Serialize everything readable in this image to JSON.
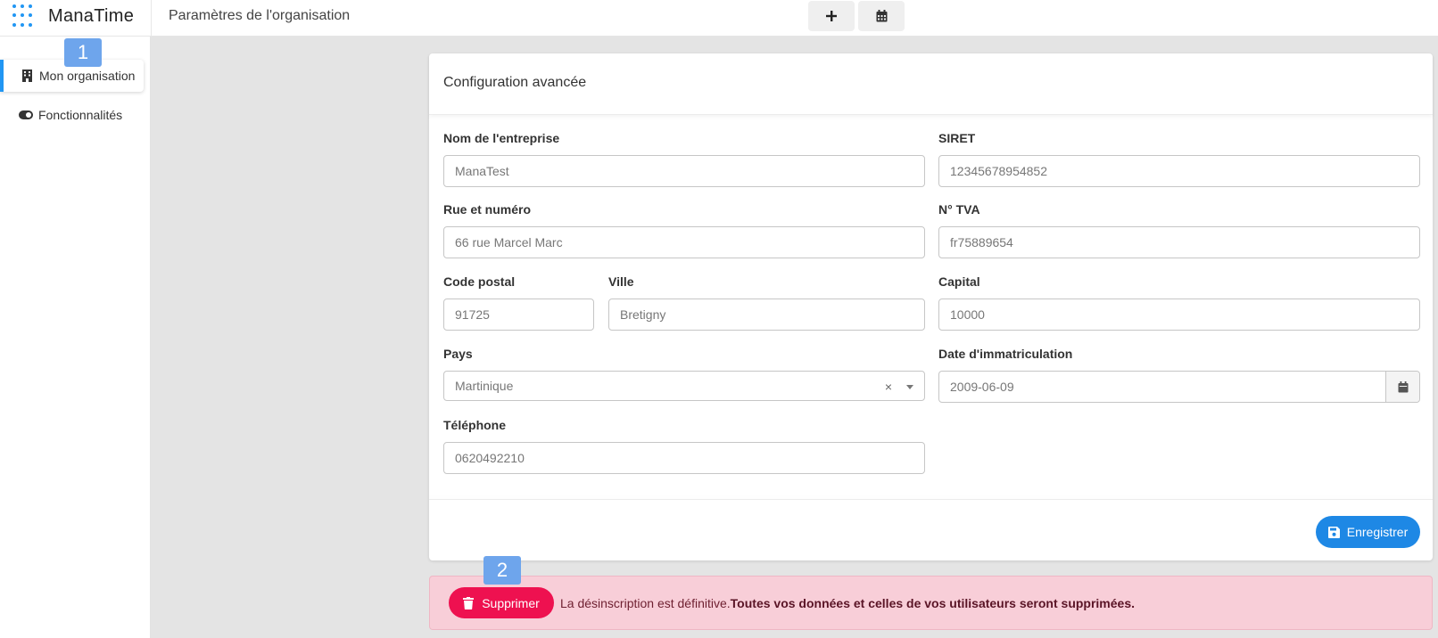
{
  "app": {
    "name": "ManaTime"
  },
  "header": {
    "page_title": "Paramètres de l'organisation"
  },
  "sidebar": {
    "items": [
      {
        "label": "Mon organisation",
        "icon": "building-icon",
        "active": true
      },
      {
        "label": "Fonctionnalités",
        "icon": "toggle-icon",
        "active": false
      }
    ]
  },
  "badges": {
    "first": "1",
    "second": "2"
  },
  "form": {
    "title": "Configuration avancée",
    "company_name": {
      "label": "Nom de l'entreprise",
      "value": "ManaTest"
    },
    "siret": {
      "label": "SIRET",
      "value": "12345678954852"
    },
    "street": {
      "label": "Rue et numéro",
      "value": "66 rue Marcel Marc"
    },
    "vat": {
      "label": "N° TVA",
      "value": "fr75889654"
    },
    "postal_code": {
      "label": "Code postal",
      "value": "91725"
    },
    "city": {
      "label": "Ville",
      "value": "Bretigny"
    },
    "capital": {
      "label": "Capital",
      "value": "10000"
    },
    "country": {
      "label": "Pays",
      "value": "Martinique",
      "clear": "×"
    },
    "registration_date": {
      "label": "Date d'immatriculation",
      "value": "2009-06-09"
    },
    "phone": {
      "label": "Téléphone",
      "value": "0620492210"
    },
    "save_label": "Enregistrer"
  },
  "danger_zone": {
    "delete_label": "Supprimer",
    "warning_text": "La désinscription est définitive.",
    "warning_bold": "Toutes vos données et celles de vos utilisateurs seront supprimées."
  },
  "colors": {
    "accent": "#2196f3",
    "save_button": "#1e88e5",
    "delete_button": "#ee1150",
    "danger_background": "#f8ced8"
  }
}
